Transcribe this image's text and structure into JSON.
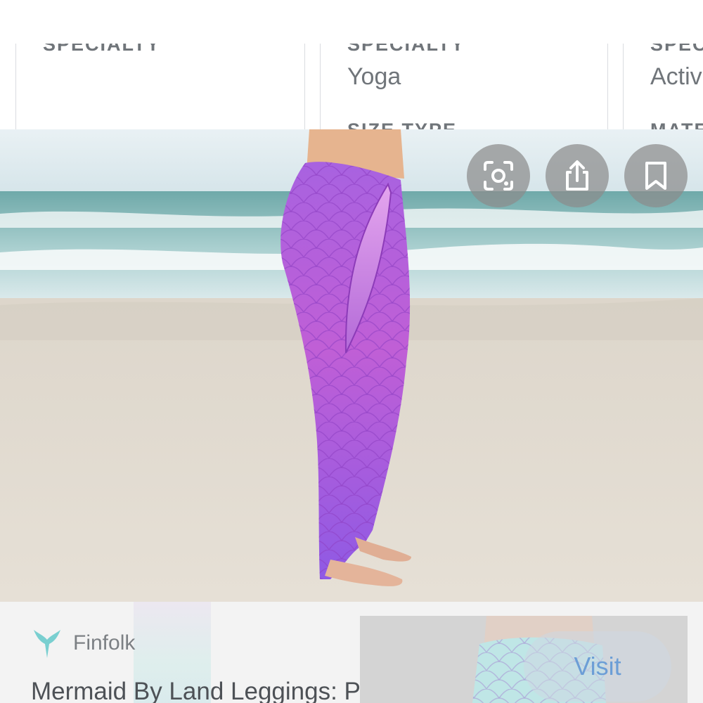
{
  "specs": [
    {
      "heading": "SPECIALTY",
      "value": ""
    },
    {
      "heading": "SPECIALTY",
      "value": "Yoga",
      "next_heading": "SIZE TYPE"
    },
    {
      "heading": "SPECIALTY",
      "value": "Activ",
      "next_heading": "MATE"
    }
  ],
  "actions": {
    "lens_icon": "lens-scan-icon",
    "share_icon": "share-icon",
    "save_icon": "bookmark-icon"
  },
  "related": {
    "source": "Finfolk",
    "title": "Mermaid By Land Leggings: Purple",
    "visit_label": "Visit"
  },
  "colors": {
    "accent_link": "#6c9ed6",
    "legging_purple": "#b35fdc",
    "logo_teal": "#79cfd0"
  }
}
